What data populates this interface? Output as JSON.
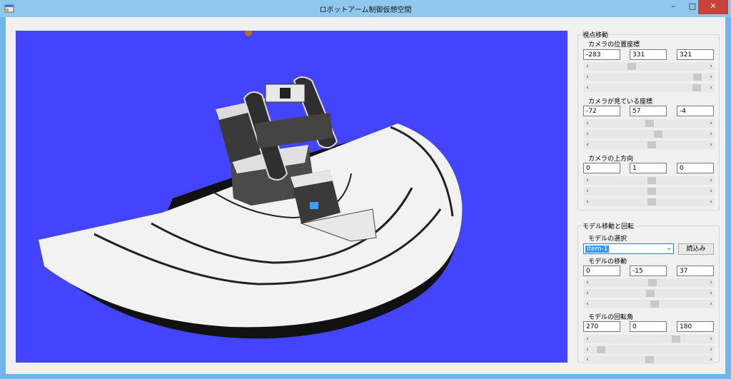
{
  "window": {
    "title": "ロボットアーム制御仮想空間",
    "minimize": "–",
    "maximize": "□",
    "close": "✕"
  },
  "viewpoint": {
    "group_title": "視点移動",
    "camera_position": {
      "label": "カメラの位置座標",
      "x": "-283",
      "y": "331",
      "z": "321",
      "sliders": [
        0.34,
        0.95,
        0.94
      ]
    },
    "camera_target": {
      "label": "カメラが見ている座標",
      "x": "-72",
      "y": "57",
      "z": "-4",
      "sliders": [
        0.5,
        0.58,
        0.52
      ]
    },
    "camera_up": {
      "label": "カメラの上方向",
      "x": "0",
      "y": "1",
      "z": "0",
      "sliders": [
        0.52,
        0.52,
        0.52
      ]
    }
  },
  "model": {
    "group_title": "モデル移動と回転",
    "selection": {
      "label": "モデルの選択",
      "value": "item-1",
      "load_button": "読込み"
    },
    "position": {
      "label": "モデルの移動",
      "x": "0",
      "y": "-15",
      "z": "37",
      "sliders": [
        0.53,
        0.51,
        0.55
      ]
    },
    "rotation": {
      "label": "モデルの回転角",
      "x": "270",
      "y": "0",
      "z": "180",
      "sliders": [
        0.75,
        0.05,
        0.5
      ]
    }
  },
  "icons": {
    "app": "app-icon",
    "scroll_left": "‹",
    "scroll_right": "›",
    "dropdown": "⌄"
  }
}
